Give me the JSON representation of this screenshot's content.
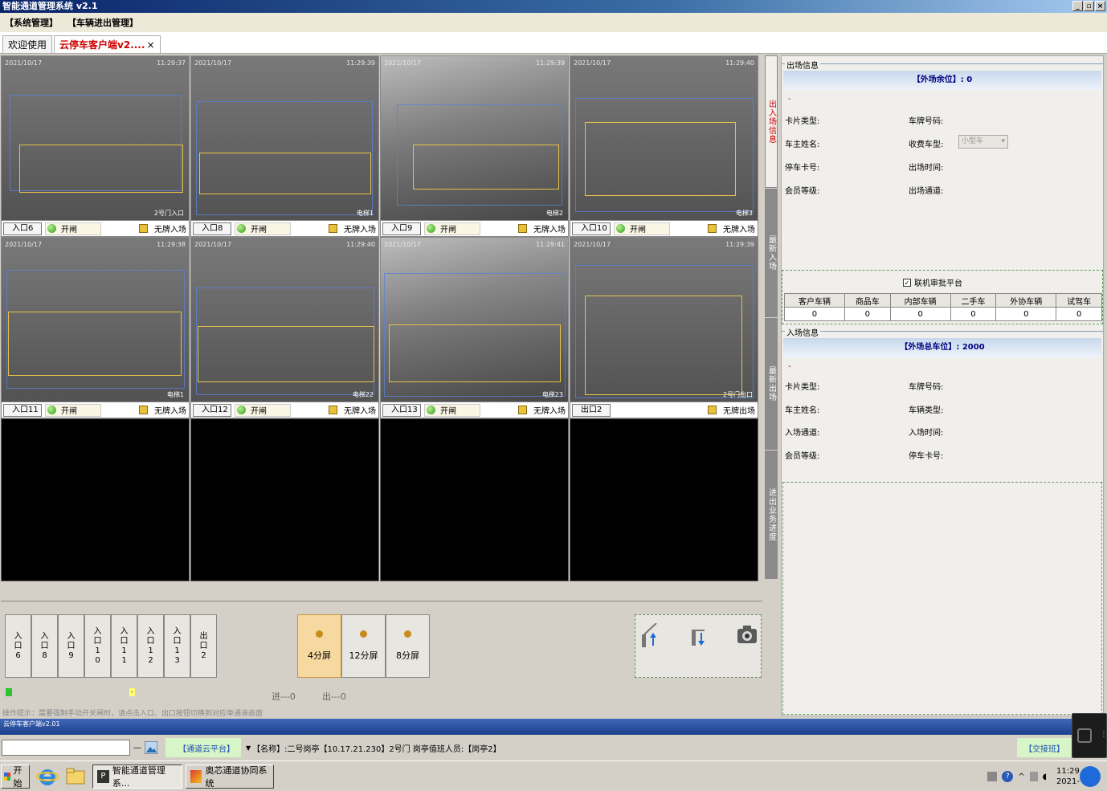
{
  "window": {
    "title": "智能通道管理系统 v2.1",
    "buttons": [
      "_",
      "▫",
      "×"
    ]
  },
  "menu": [
    "【系统管理】",
    "【车辆进出管理】"
  ],
  "tabs": [
    {
      "label": "欢迎使用"
    },
    {
      "label": "云停车客户端v2....",
      "close": "×"
    }
  ],
  "cameras": [
    {
      "ts": "2021/10/17",
      "time": "11:29:37",
      "label": "2号门入口",
      "gate": "入口6",
      "open": "开闸",
      "noplate": "无牌入场"
    },
    {
      "ts": "2021/10/17",
      "time": "11:29:39",
      "label": "电梯1",
      "gate": "入口8",
      "open": "开闸",
      "noplate": "无牌入场"
    },
    {
      "ts": "2021/10/17",
      "time": "11:29:39",
      "label": "电梯2",
      "gate": "入口9",
      "open": "开闸",
      "noplate": "无牌入场"
    },
    {
      "ts": "2021/10/17",
      "time": "11:29:40",
      "label": "电梯3",
      "gate": "入口10",
      "open": "开闸",
      "noplate": "无牌入场"
    },
    {
      "ts": "2021/10/17",
      "time": "11:29:38",
      "label": "电梯1",
      "gate": "入口11",
      "open": "开闸",
      "noplate": "无牌入场"
    },
    {
      "ts": "2021/10/17",
      "time": "11:29:40",
      "label": "电梯22",
      "gate": "入口12",
      "open": "开闸",
      "noplate": "无牌入场"
    },
    {
      "ts": "2021/10/17",
      "time": "11:29:41",
      "label": "电梯23",
      "gate": "入口13",
      "open": "开闸",
      "noplate": "无牌入场"
    },
    {
      "ts": "2021/10/17",
      "time": "11:29:39",
      "label": "2号门出口",
      "gate": "出口2",
      "open": "",
      "noplate": "无牌出场"
    }
  ],
  "gate_buttons": [
    "入口6",
    "入口8",
    "入口9",
    "入口10",
    "入口11",
    "入口12",
    "入口13",
    "出口2"
  ],
  "split_buttons": [
    "4分屏",
    "12分屏",
    "8分屏"
  ],
  "counters": {
    "in": "进---0",
    "out": "出---0"
  },
  "hint": "操作提示：需要强制手动开关闸时，请点击入口、出口按钮切换到对应单通道画面",
  "sidetabs": [
    "出入场信息",
    "最新入场",
    "最新出场",
    "进出业务进度"
  ],
  "exit_info": {
    "legend": "出场信息",
    "band": "【外场余位】: 0",
    "dash": "-",
    "fields": [
      {
        "label": "卡片类型:",
        "value": ""
      },
      {
        "label": "车牌号码:",
        "value": ""
      },
      {
        "label": "车主姓名:",
        "value": ""
      },
      {
        "label": "收费车型:",
        "value": "小型车"
      },
      {
        "label": "停车卡号:",
        "value": ""
      },
      {
        "label": "出场时间:",
        "value": ""
      },
      {
        "label": "会员等级:",
        "value": ""
      },
      {
        "label": "出场通道:",
        "value": ""
      }
    ]
  },
  "approval": {
    "checkbox": "联机审批平台",
    "checked": true
  },
  "stats": {
    "headers": [
      "客户车辆",
      "商品车",
      "内部车辆",
      "二手车",
      "外协车辆",
      "试驾车"
    ],
    "values": [
      "0",
      "0",
      "0",
      "0",
      "0",
      "0"
    ]
  },
  "entry_info": {
    "legend": "入场信息",
    "band": "【外场总车位】: 2000",
    "dash": "-",
    "fields": [
      {
        "label": "卡片类型:",
        "value": ""
      },
      {
        "label": "车牌号码:",
        "value": ""
      },
      {
        "label": "车主姓名:",
        "value": ""
      },
      {
        "label": "车辆类型:",
        "value": ""
      },
      {
        "label": "入场通道:",
        "value": ""
      },
      {
        "label": "入场时间:",
        "value": ""
      },
      {
        "label": "会员等级:",
        "value": ""
      },
      {
        "label": "停车卡号:",
        "value": ""
      }
    ]
  },
  "blueline_text": "云停车客户端v2.01",
  "status": {
    "platform": "【通道云平台】",
    "info": "【名称】:二号岗亭【10.17.21.230】2号门  岗亭值班人员:【岗亭2】",
    "handover": "【交接班】"
  },
  "taskbar": {
    "start": "开始",
    "apps": [
      "智能通道管理系...",
      "奥芯通道协同系统"
    ],
    "clock": "11:29",
    "date": "2021-"
  }
}
